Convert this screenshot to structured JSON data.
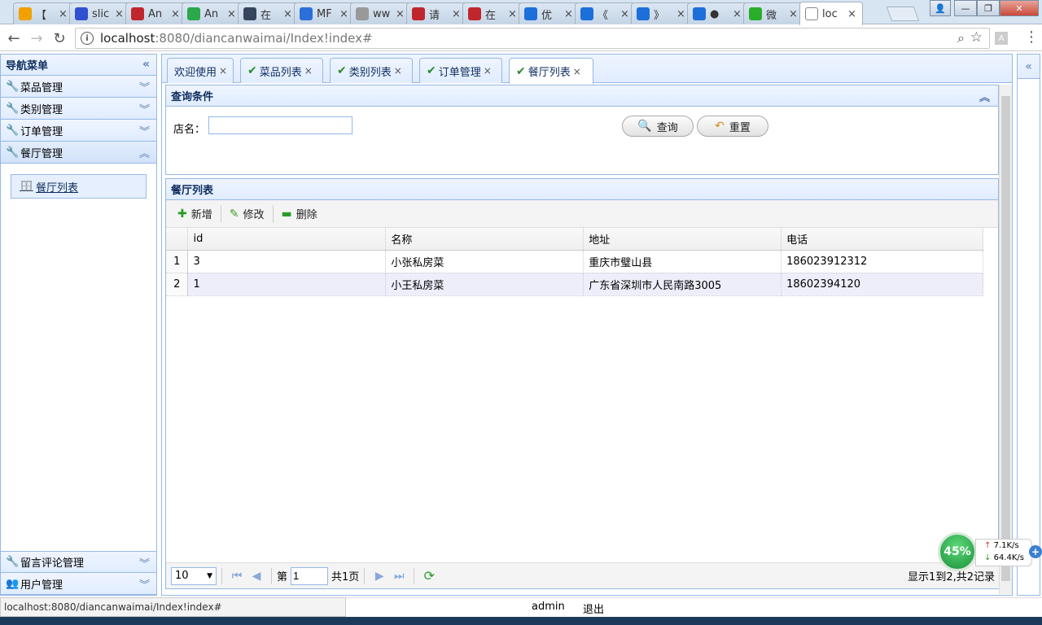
{
  "browser": {
    "tabs": [
      {
        "title": "【",
        "color": "#f0a000"
      },
      {
        "title": "slic",
        "color": "#3050d0"
      },
      {
        "title": "An",
        "color": "#c0272d"
      },
      {
        "title": "An",
        "color": "#2aa84a"
      },
      {
        "title": "在",
        "color": "#35465c"
      },
      {
        "title": "MF",
        "color": "#2a70d8"
      },
      {
        "title": "ww",
        "color": "#999999"
      },
      {
        "title": "请",
        "color": "#c0272d"
      },
      {
        "title": "在",
        "color": "#c0272d"
      },
      {
        "title": "优",
        "color": "#1d6fd9"
      },
      {
        "title": "《",
        "color": "#1d6fd9"
      },
      {
        "title": "》",
        "color": "#1d6fd9"
      },
      {
        "title": "●",
        "color": "#1d6fd9"
      },
      {
        "title": "微",
        "color": "#2aae2a"
      },
      {
        "title": "loc",
        "color": "#ffffff"
      }
    ],
    "url_host": "localhost",
    "url_path": ":8080/diancanwaimai/Index!index#"
  },
  "sidebar": {
    "title": "导航菜单",
    "sections": [
      {
        "label": "菜品管理"
      },
      {
        "label": "类别管理"
      },
      {
        "label": "订单管理"
      },
      {
        "label": "餐厅管理"
      }
    ],
    "open_item": "餐厅列表",
    "bottom_sections": [
      {
        "label": "留言评论管理"
      },
      {
        "label": "用户管理"
      }
    ]
  },
  "page_tabs": [
    {
      "label": "欢迎使用"
    },
    {
      "label": "菜品列表"
    },
    {
      "label": "类别列表"
    },
    {
      "label": "订单管理"
    },
    {
      "label": "餐厅列表"
    }
  ],
  "query": {
    "title": "查询条件",
    "shop_label": "店名：",
    "shop_value": "",
    "search_label": "查询",
    "reset_label": "重置"
  },
  "grid": {
    "title": "餐厅列表",
    "toolbar": {
      "add": "新增",
      "edit": "修改",
      "delete": "删除"
    },
    "columns": [
      "id",
      "名称",
      "地址",
      "电话"
    ],
    "rows": [
      {
        "n": "1",
        "id": "3",
        "name": "小张私房菜",
        "address": "重庆市璧山县",
        "phone": "186023912312"
      },
      {
        "n": "2",
        "id": "1",
        "name": "小王私房菜",
        "address": "广东省深圳市人民南路3005",
        "phone": "18602394120"
      }
    ],
    "pager": {
      "page_size": "10",
      "page_prefix": "第",
      "page_value": "1",
      "page_total": "共1页",
      "summary": "显示1到2,共2记录"
    }
  },
  "status": {
    "url": "localhost:8080/diancanwaimai/Index!index#",
    "user": "admin",
    "logout": "退出"
  },
  "netmon": {
    "percent": "45%",
    "up": "7.1K/s",
    "down": "64.4K/s"
  }
}
